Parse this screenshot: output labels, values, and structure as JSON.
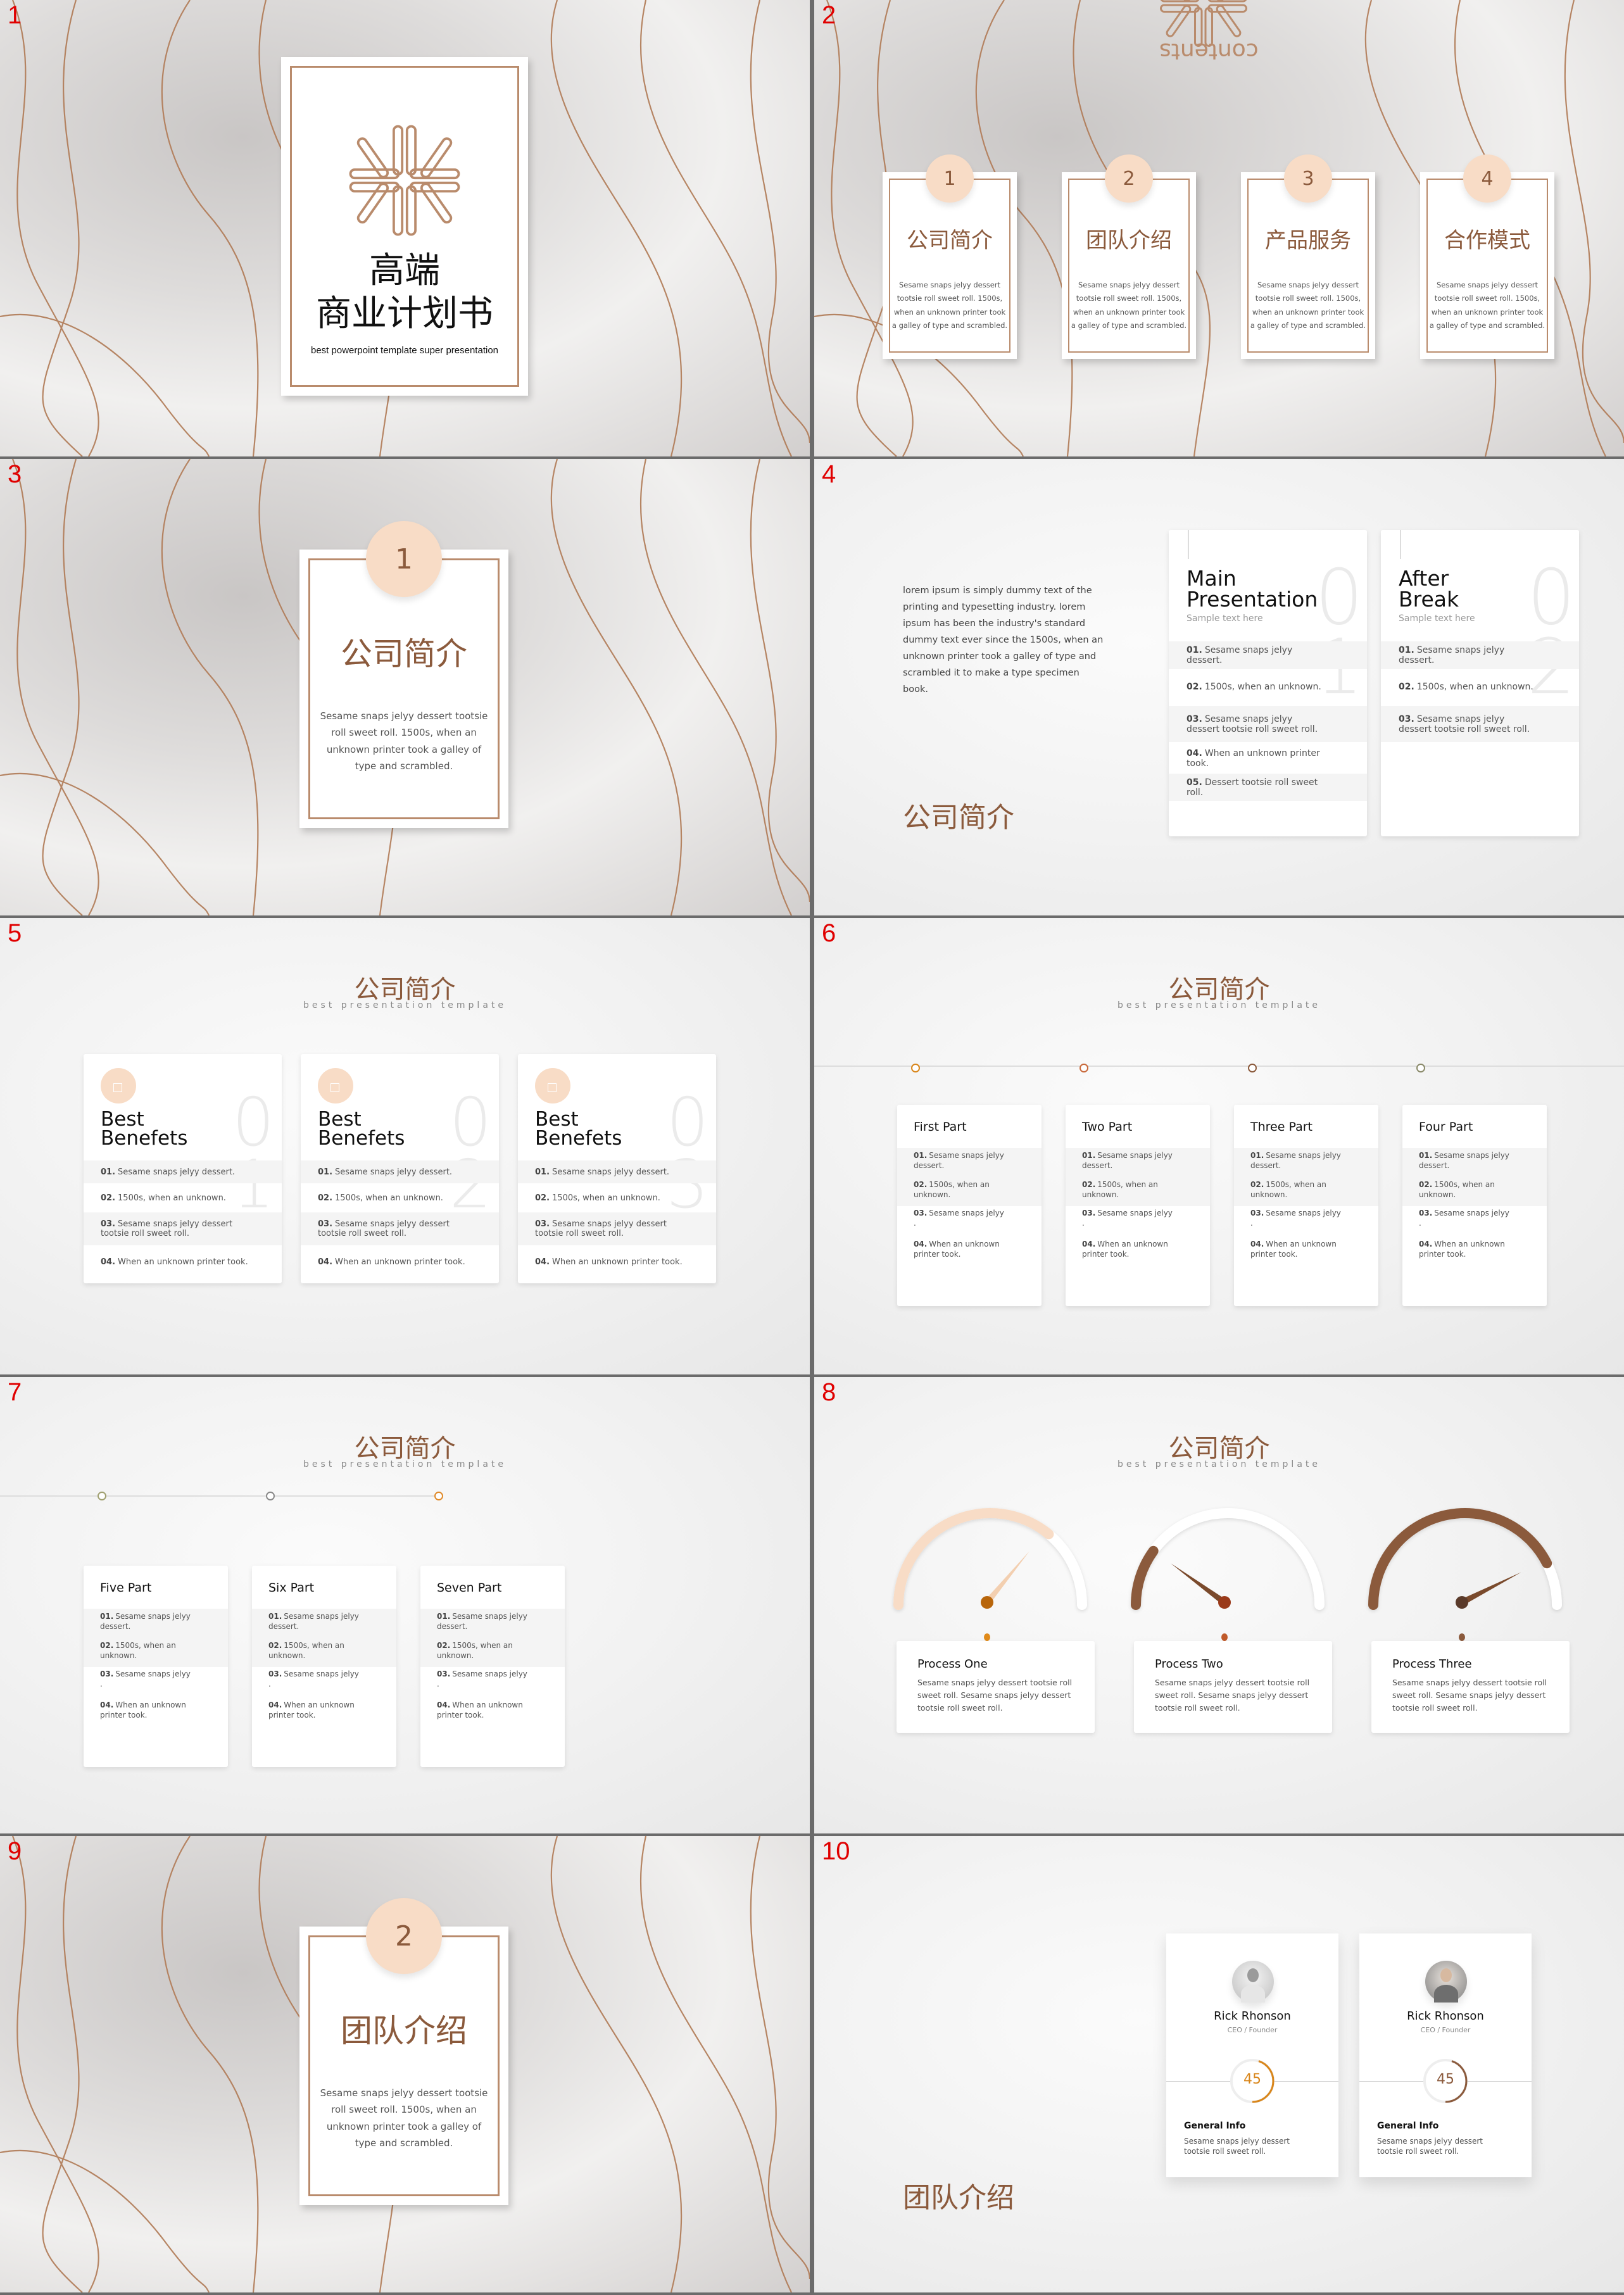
{
  "colors": {
    "brown": "#8b5a3c",
    "peach": "#f8dcc6",
    "orange": "#d9861a",
    "rust": "#b85a2e",
    "dark_brown": "#6b4030",
    "slide_number": "#e00000"
  },
  "slides": [
    {
      "number": "1",
      "title_line1": "高端",
      "title_line2": "商业计划书",
      "subtitle": "best powerpoint template super presentation",
      "logo_icon": "snowflake-logo-icon"
    },
    {
      "number": "2",
      "contents_label": "contents",
      "items": [
        {
          "num": "1",
          "title": "公司简介",
          "text": "Sesame snaps jelyy dessert tootsie roll sweet roll. 1500s, when an unknown printer took a galley of type and scrambled."
        },
        {
          "num": "2",
          "title": "团队介绍",
          "text": "Sesame snaps jelyy dessert tootsie roll sweet roll. 1500s, when an unknown printer took a galley of type and scrambled."
        },
        {
          "num": "3",
          "title": "产品服务",
          "text": "Sesame snaps jelyy dessert tootsie roll sweet roll. 1500s, when an unknown printer took a galley of type and scrambled."
        },
        {
          "num": "4",
          "title": "合作模式",
          "text": "Sesame snaps jelyy dessert tootsie roll sweet roll. 1500s, when an unknown printer took a galley of type and scrambled."
        }
      ]
    },
    {
      "number": "3",
      "badge": "1",
      "title": "公司简介",
      "text": "Sesame snaps jelyy dessert tootsie roll sweet roll. 1500s, when an unknown printer took a galley of type and scrambled."
    },
    {
      "number": "4",
      "paragraph": "lorem ipsum is simply dummy text of the printing and typesetting industry. lorem ipsum has been the industry's standard dummy text ever since the 1500s, when an unknown printer took a galley of type and scrambled it to make a type specimen book.",
      "title": "公司简介",
      "cards": [
        {
          "title_line1": "Main",
          "title_line2": "Presentation",
          "sub": "Sample text here",
          "bignum_top": "0",
          "bignum_bottom": "1",
          "rows": [
            {
              "n": "01.",
              "t": "Sesame snaps jelyy dessert."
            },
            {
              "n": "02.",
              "t": "1500s, when an unknown."
            },
            {
              "n": "03.",
              "t": "Sesame snaps jelyy dessert tootsie roll sweet roll."
            },
            {
              "n": "04.",
              "t": "When an unknown printer took."
            },
            {
              "n": "05.",
              "t": "Dessert tootsie roll sweet roll."
            }
          ]
        },
        {
          "title_line1": "After",
          "title_line2": "Break",
          "sub": "Sample text here",
          "bignum_top": "0",
          "bignum_bottom": "2",
          "rows": [
            {
              "n": "01.",
              "t": "Sesame snaps jelyy dessert."
            },
            {
              "n": "02.",
              "t": "1500s, when an unknown."
            },
            {
              "n": "03.",
              "t": "Sesame snaps jelyy dessert tootsie roll sweet roll."
            }
          ]
        }
      ]
    },
    {
      "number": "5",
      "title": "公司简介",
      "subtitle": "best presentation template",
      "cards": [
        {
          "title_line1": "Best",
          "title_line2": "Benefets",
          "bignum_top": "0",
          "bignum_bottom": "1",
          "rows": [
            {
              "n": "01.",
              "t": "Sesame snaps jelyy dessert."
            },
            {
              "n": "02.",
              "t": "1500s, when an unknown."
            },
            {
              "n": "03.",
              "t": "Sesame snaps jelyy dessert tootsie roll sweet roll."
            },
            {
              "n": "04.",
              "t": "When an unknown printer took."
            }
          ]
        },
        {
          "title_line1": "Best",
          "title_line2": "Benefets",
          "bignum_top": "0",
          "bignum_bottom": "2",
          "rows": [
            {
              "n": "01.",
              "t": "Sesame snaps jelyy dessert."
            },
            {
              "n": "02.",
              "t": "1500s, when an unknown."
            },
            {
              "n": "03.",
              "t": "Sesame snaps jelyy dessert tootsie roll sweet roll."
            },
            {
              "n": "04.",
              "t": "When an unknown printer took."
            }
          ]
        },
        {
          "title_line1": "Best",
          "title_line2": "Benefets",
          "bignum_top": "0",
          "bignum_bottom": "3",
          "rows": [
            {
              "n": "01.",
              "t": "Sesame snaps jelyy dessert."
            },
            {
              "n": "02.",
              "t": "1500s, when an unknown."
            },
            {
              "n": "03.",
              "t": "Sesame snaps jelyy dessert tootsie roll sweet roll."
            },
            {
              "n": "04.",
              "t": "When an unknown printer took."
            }
          ]
        }
      ]
    },
    {
      "number": "6",
      "title": "公司简介",
      "subtitle": "best presentation template",
      "parts": [
        {
          "title": "First Part",
          "dot_color": "#d9861a"
        },
        {
          "title": "Two Part",
          "dot_color": "#c8683a"
        },
        {
          "title": "Three Part",
          "dot_color": "#8b5a3c"
        },
        {
          "title": "Four Part",
          "dot_color": "#8a8a6a"
        }
      ],
      "rows": [
        {
          "n": "01.",
          "t": "Sesame snaps jelyy dessert."
        },
        {
          "n": "02.",
          "t": "1500s, when an unknown."
        },
        {
          "n": "03.",
          "t": "Sesame snaps jelyy ."
        },
        {
          "n": "04.",
          "t": "When an unknown printer took."
        }
      ]
    },
    {
      "number": "7",
      "title": "公司简介",
      "subtitle": "best presentation template",
      "parts": [
        {
          "title": "Five Part",
          "dot_color": "#a0a070"
        },
        {
          "title": "Six Part",
          "dot_color": "#8a8a8a"
        },
        {
          "title": "Seven Part",
          "dot_color": "#e08a2a"
        }
      ],
      "rows": [
        {
          "n": "01.",
          "t": "Sesame snaps jelyy dessert."
        },
        {
          "n": "02.",
          "t": "1500s, when an unknown."
        },
        {
          "n": "03.",
          "t": "Sesame snaps jelyy ."
        },
        {
          "n": "04.",
          "t": "When an unknown printer took."
        }
      ]
    },
    {
      "number": "8",
      "title": "公司简介",
      "subtitle": "best presentation template",
      "gauges": [
        {
          "title": "Process One",
          "text": "Sesame snaps jelyy dessert tootsie roll sweet roll. Sesame snaps jelyy dessert tootsie roll sweet roll.",
          "fill_fraction": 0.72,
          "arc_color": "#f8dcc6",
          "needle_color": "#f3cfb0",
          "hub_color": "#b8650a",
          "pin_color": "#e08a1a"
        },
        {
          "title": "Process Two",
          "text": "Sesame snaps jelyy dessert tootsie roll sweet roll. Sesame snaps jelyy dessert tootsie roll sweet roll.",
          "fill_fraction": 0.2,
          "arc_color": "#8b5a3c",
          "needle_color": "#7a4a2c",
          "hub_color": "#9a3a1a",
          "pin_color": "#c05a2a"
        },
        {
          "title": "Process Three",
          "text": "Sesame snaps jelyy dessert tootsie roll sweet roll. Sesame snaps jelyy dessert tootsie roll sweet roll.",
          "fill_fraction": 0.85,
          "arc_color": "#8b5a3c",
          "needle_color": "#7a4a2c",
          "hub_color": "#5a3a2a",
          "pin_color": "#8b5a3c"
        }
      ]
    },
    {
      "number": "9",
      "badge": "2",
      "title": "团队介绍",
      "text": "Sesame snaps jelyy dessert tootsie roll sweet roll. 1500s, when an unknown printer took a galley of type and scrambled."
    },
    {
      "number": "10",
      "title": "团队介绍",
      "members": [
        {
          "name": "Rick Rhonson",
          "role": "CEO / Founder",
          "score": "45",
          "score_fraction": 0.45,
          "ring_color": "#d9861a",
          "info_title": "General Info",
          "info_text": "Sesame snaps jelyy dessert tootsie roll sweet roll."
        },
        {
          "name": "Rick Rhonson",
          "role": "CEO / Founder",
          "score": "45",
          "score_fraction": 0.45,
          "ring_color": "#8b5a3c",
          "info_title": "General Info",
          "info_text": "Sesame snaps jelyy dessert tootsie roll sweet roll."
        }
      ]
    }
  ]
}
